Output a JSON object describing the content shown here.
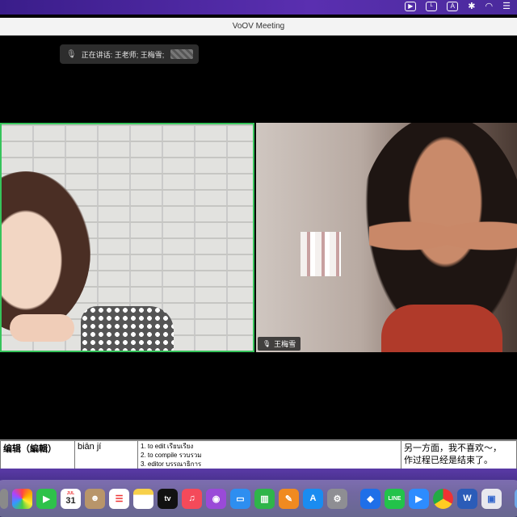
{
  "window": {
    "title": "VoOV Meeting"
  },
  "speaking_indicator": {
    "text": "正在讲话: 王老师; 王梅雪;"
  },
  "participants": {
    "right": {
      "name": "王梅雪"
    }
  },
  "document": {
    "word": "编辑（編輯）",
    "pinyin": "biān jí",
    "meanings": [
      "1. to edit  เรียบเรียง",
      "2. to compile  รวบรวม",
      "3. editor  บรรณาธิการ"
    ],
    "example": [
      "另一方面，我不喜欢〜，",
      "作过程已经是结束了。"
    ]
  },
  "dock": {
    "calendar_day": "31",
    "calendar_month": "JUL",
    "tv_label": "tv"
  },
  "colors": {
    "active_speaker_border": "#36c45b",
    "menubar": "#4a2a9c"
  }
}
